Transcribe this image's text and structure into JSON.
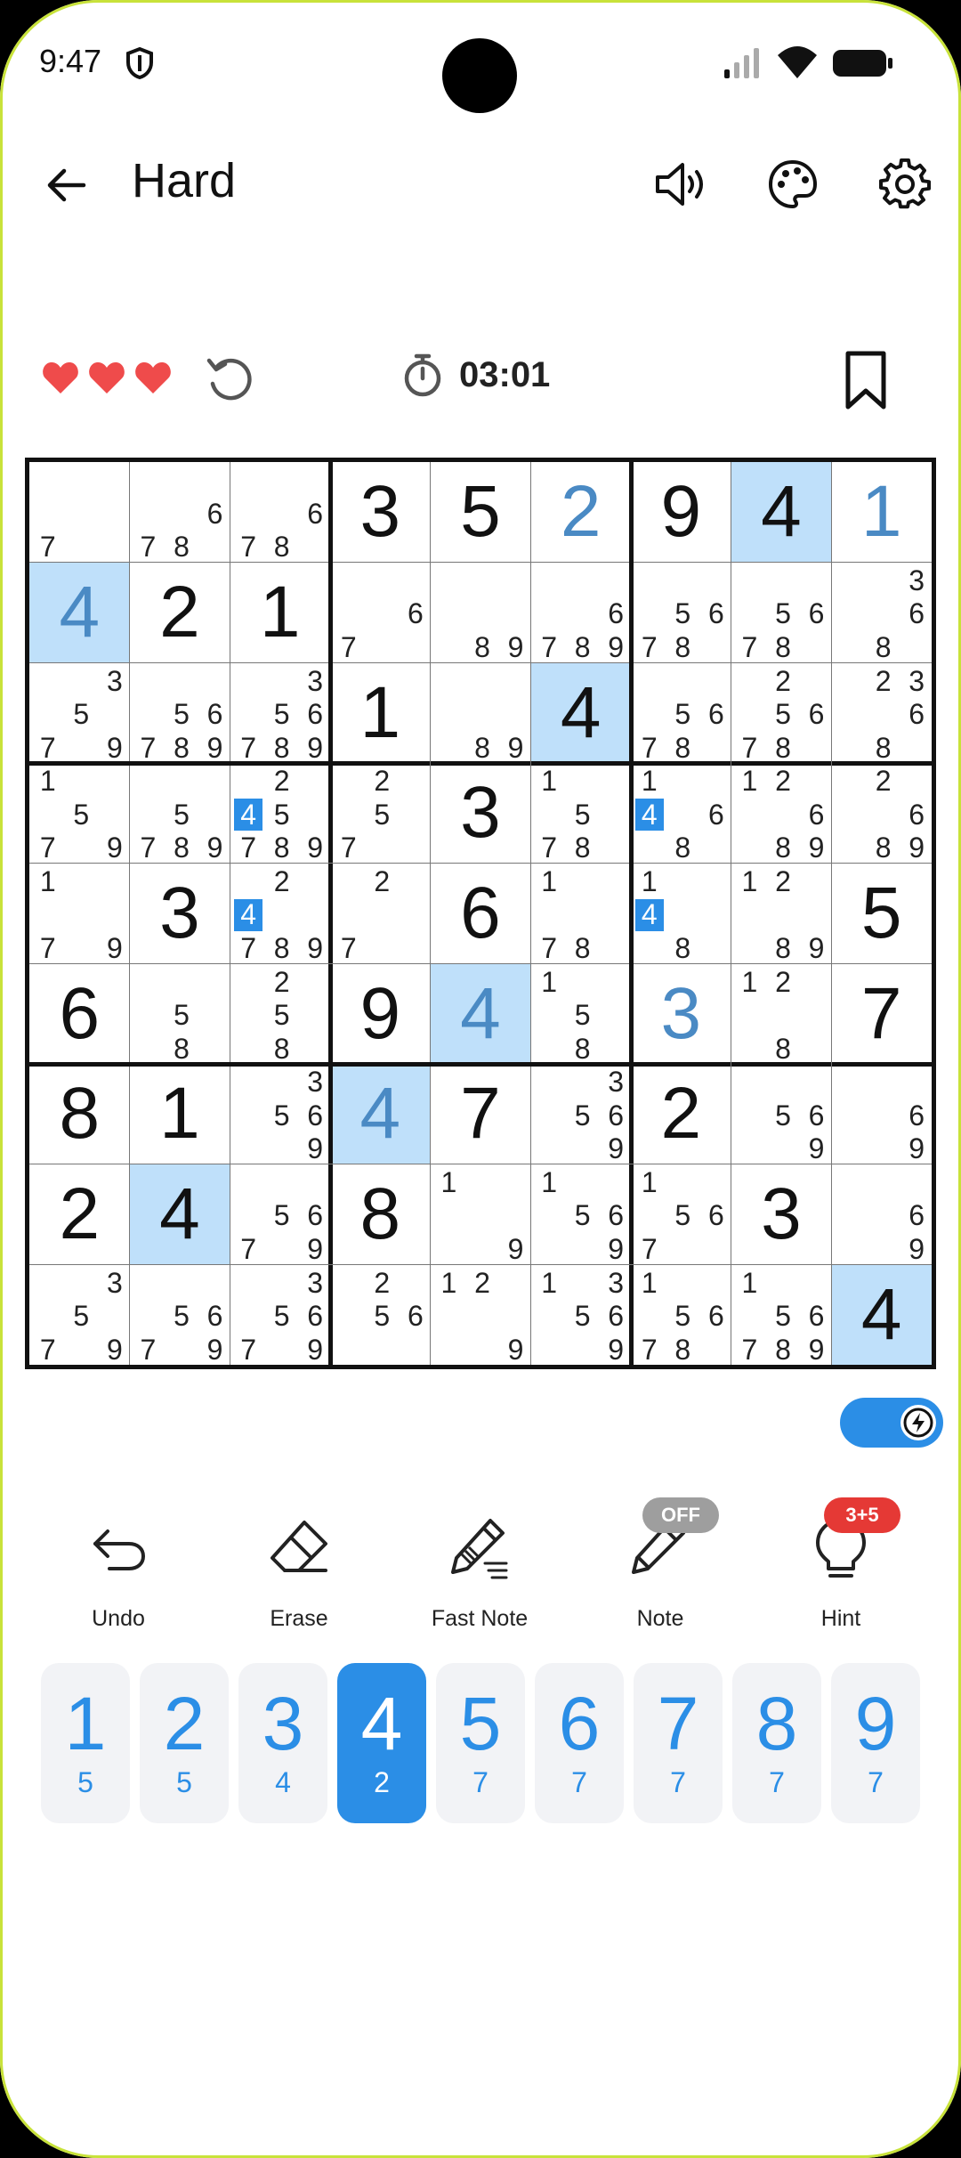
{
  "status": {
    "time": "9:47"
  },
  "header": {
    "title": "Hard"
  },
  "game": {
    "lives": 3,
    "timer": "03:01"
  },
  "colors": {
    "accent": "#2b8ee6",
    "highlight": "#bfe0fa",
    "given": "#111111",
    "entered": "#4a8ac4",
    "heart": "#ef4b4b",
    "hint_badge": "#e53935",
    "off_badge": "#9e9e9e"
  },
  "board": {
    "cells": [
      [
        {
          "n": "7"
        },
        {
          "n": "678"
        },
        {
          "n": "678"
        },
        {
          "v": "3"
        },
        {
          "v": "5"
        },
        {
          "v": "2",
          "t": "e"
        },
        {
          "v": "9"
        },
        {
          "v": "4",
          "h": 1
        },
        {
          "v": "1",
          "t": "e"
        }
      ],
      [
        {
          "v": "4",
          "t": "e",
          "h": 1
        },
        {
          "v": "2"
        },
        {
          "v": "1"
        },
        {
          "n": "67"
        },
        {
          "n": "89"
        },
        {
          "n": "6789"
        },
        {
          "n": "5678"
        },
        {
          "n": "5678"
        },
        {
          "n": "368"
        }
      ],
      [
        {
          "n": "3579"
        },
        {
          "n": "56789"
        },
        {
          "n": "356789"
        },
        {
          "v": "1"
        },
        {
          "n": "89"
        },
        {
          "v": "4",
          "h": 1
        },
        {
          "n": "5678"
        },
        {
          "n": "25678"
        },
        {
          "n": "2368"
        }
      ],
      [
        {
          "n": "1579"
        },
        {
          "n": "5789"
        },
        {
          "n": "245789",
          "x": "4"
        },
        {
          "n": "257"
        },
        {
          "v": "3"
        },
        {
          "n": "1578"
        },
        {
          "n": "1468",
          "x": "4"
        },
        {
          "n": "12689"
        },
        {
          "n": "2689"
        }
      ],
      [
        {
          "n": "179"
        },
        {
          "v": "3"
        },
        {
          "n": "24789",
          "x": "4"
        },
        {
          "n": "27"
        },
        {
          "v": "6"
        },
        {
          "n": "178"
        },
        {
          "n": "148",
          "x": "4"
        },
        {
          "n": "1289"
        },
        {
          "v": "5"
        }
      ],
      [
        {
          "v": "6"
        },
        {
          "n": "58"
        },
        {
          "n": "258"
        },
        {
          "v": "9"
        },
        {
          "v": "4",
          "t": "e",
          "h": 1
        },
        {
          "n": "158"
        },
        {
          "v": "3",
          "t": "e"
        },
        {
          "n": "128"
        },
        {
          "v": "7"
        }
      ],
      [
        {
          "v": "8"
        },
        {
          "v": "1"
        },
        {
          "n": "3569"
        },
        {
          "v": "4",
          "t": "e",
          "h": 1
        },
        {
          "v": "7"
        },
        {
          "n": "3569"
        },
        {
          "v": "2"
        },
        {
          "n": "569"
        },
        {
          "n": "69"
        }
      ],
      [
        {
          "v": "2"
        },
        {
          "v": "4",
          "h": 1
        },
        {
          "n": "5679"
        },
        {
          "v": "8"
        },
        {
          "n": "19"
        },
        {
          "n": "1569"
        },
        {
          "n": "1567"
        },
        {
          "v": "3"
        },
        {
          "n": "69"
        }
      ],
      [
        {
          "n": "3579"
        },
        {
          "n": "5679"
        },
        {
          "n": "35679"
        },
        {
          "n": "256"
        },
        {
          "n": "129"
        },
        {
          "n": "13569"
        },
        {
          "n": "15678"
        },
        {
          "n": "156789"
        },
        {
          "v": "4",
          "h": 1
        }
      ]
    ]
  },
  "tools": [
    {
      "label": "Undo",
      "icon": "undo-icon"
    },
    {
      "label": "Erase",
      "icon": "eraser-icon"
    },
    {
      "label": "Fast Note",
      "icon": "fast-note-icon"
    },
    {
      "label": "Note",
      "icon": "pencil-icon",
      "badge": "OFF"
    },
    {
      "label": "Hint",
      "icon": "lightbulb-icon",
      "badge": "3+5"
    }
  ],
  "numpad": [
    {
      "digit": "1",
      "count": "5"
    },
    {
      "digit": "2",
      "count": "5"
    },
    {
      "digit": "3",
      "count": "4"
    },
    {
      "digit": "4",
      "count": "2",
      "selected": true
    },
    {
      "digit": "5",
      "count": "7"
    },
    {
      "digit": "6",
      "count": "7"
    },
    {
      "digit": "7",
      "count": "7"
    },
    {
      "digit": "8",
      "count": "7"
    },
    {
      "digit": "9",
      "count": "7"
    }
  ]
}
